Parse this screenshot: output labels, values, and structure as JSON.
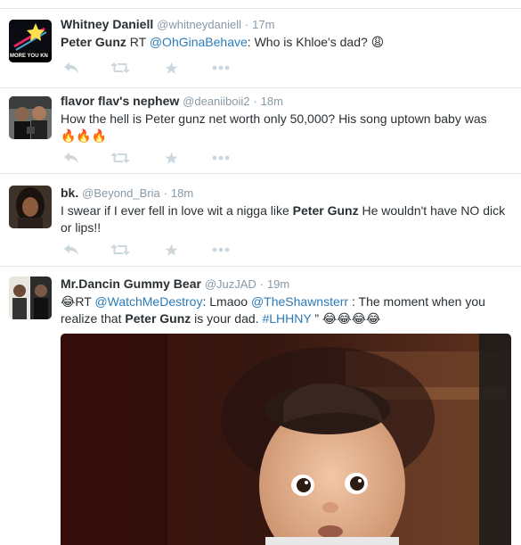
{
  "tweets": [
    {
      "name": "Whitney Daniell",
      "handle": "@whitneydaniell",
      "time": "17m",
      "avatar_text": "MORE YOU KN",
      "text_parts": [
        "Peter Gunz",
        " RT ",
        "@OhGinaBehave",
        ": Who is Khloe's dad? "
      ],
      "emoji": "😩"
    },
    {
      "name": "flavor flav's nephew",
      "handle": "@deaniiboii2",
      "time": "18m",
      "text": "How the hell is Peter gunz net worth only 50,000? His song uptown baby was",
      "emoji": "🔥🔥🔥"
    },
    {
      "name": "bk.",
      "handle": "@Beyond_Bria",
      "time": "18m",
      "text_parts": [
        "I swear if I ever fell in love wit a nigga like ",
        "Peter Gunz",
        " He wouldn't have NO dick or lips!!"
      ]
    },
    {
      "name": "Mr.Dancin Gummy Bear",
      "handle": "@JuzJAD",
      "time": "19m",
      "text_parts": [
        "😂",
        "RT ",
        "@WatchMeDestroy",
        ": Lmaoo ",
        "@TheShawnsterr",
        " : The moment when you realize that ",
        "Peter Gunz",
        " is your dad. ",
        "#LHHNY",
        " ” ",
        "😂😂😂😂"
      ]
    }
  ],
  "actions": {
    "reply_icon": "reply-icon",
    "retweet_icon": "retweet-icon",
    "favorite_icon": "favorite-icon",
    "more_icon": "more-icon"
  },
  "colors": {
    "link": "#2b7bb9",
    "muted": "#8899a6",
    "action": "#ccd6dd",
    "divider": "#e1e8ed"
  }
}
